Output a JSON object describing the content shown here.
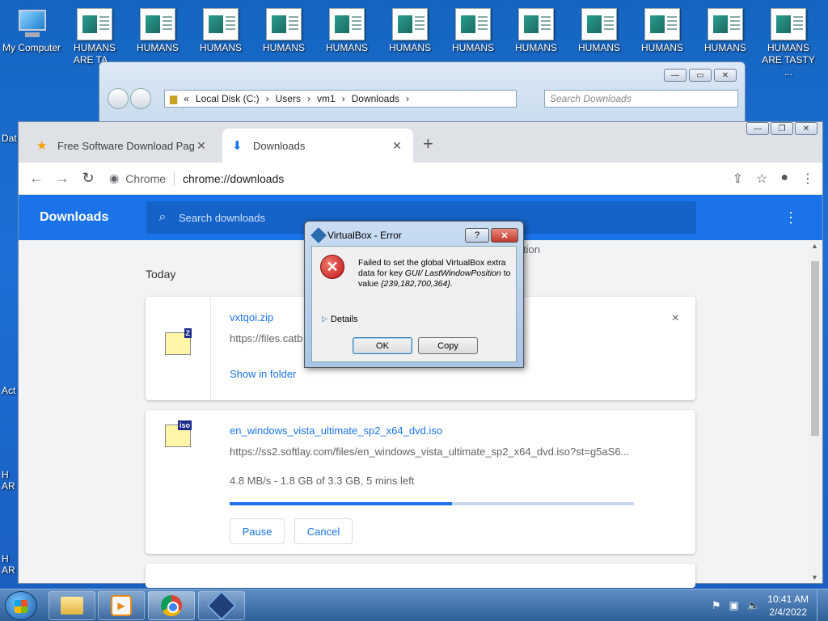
{
  "desktop": {
    "icons": [
      {
        "label": "My Computer"
      },
      {
        "label": "HUMANS\nARE TA..."
      },
      {
        "label": "HUMANS"
      },
      {
        "label": "HUMANS"
      },
      {
        "label": "HUMANS"
      },
      {
        "label": "HUMANS"
      },
      {
        "label": "HUMANS"
      },
      {
        "label": "HUMANS"
      },
      {
        "label": "HUMANS"
      },
      {
        "label": "HUMANS"
      },
      {
        "label": "HUMANS"
      },
      {
        "label": "HUMANS"
      },
      {
        "label": "HUMANS\nARE TASTY ..."
      }
    ],
    "side_fragments": [
      "Dat",
      "Act",
      "H AR",
      "H AR"
    ]
  },
  "explorer": {
    "address": [
      "«",
      "Local Disk (C:)",
      "›",
      "Users",
      "›",
      "vm1",
      "›",
      "Downloads",
      "›"
    ],
    "search_placeholder": "Search Downloads"
  },
  "chrome": {
    "tabs": [
      {
        "title": "Free Software Download Page - L",
        "icon": "star-icon"
      },
      {
        "title": "Downloads",
        "icon": "download-icon"
      }
    ],
    "new_tab": "+",
    "omnibox": {
      "chip": "Chrome",
      "url": "chrome://downloads"
    },
    "downloads_header": "Downloads",
    "search_placeholder": "Search downloads",
    "section_label": "Today",
    "partial_text": "tion",
    "items": [
      {
        "name": "vxtqoi.zip",
        "url": "https://files.catb",
        "badge": "Z",
        "action": "Show in folder",
        "remove": "×"
      },
      {
        "name": "en_windows_vista_ultimate_sp2_x64_dvd.iso",
        "url": "https://ss2.softlay.com/files/en_windows_vista_ultimate_sp2_x64_dvd.iso?st=g5aS6...",
        "badge": "iso",
        "status": "4.8 MB/s - 1.8 GB of 3.3 GB, 5 mins left",
        "progress": 0.55,
        "pause": "Pause",
        "cancel": "Cancel"
      }
    ]
  },
  "dialog": {
    "title": "VirtualBox - Error",
    "help": "?",
    "close": "✕",
    "message_line1": "Failed to set the global VirtualBox",
    "message_line2": "extra data for key",
    "message_key": "GUI/ LastWindowPosition",
    "message_line3": "to value",
    "message_value": "{239,182,700,364}.",
    "details": "Details",
    "ok": "OK",
    "copy": "Copy"
  },
  "taskbar": {
    "time": "10:41 AM",
    "date": "2/4/2022"
  },
  "colors": {
    "accent": "#1a73e8",
    "desktop": "#1e6fd6",
    "error": "#c0141a"
  }
}
